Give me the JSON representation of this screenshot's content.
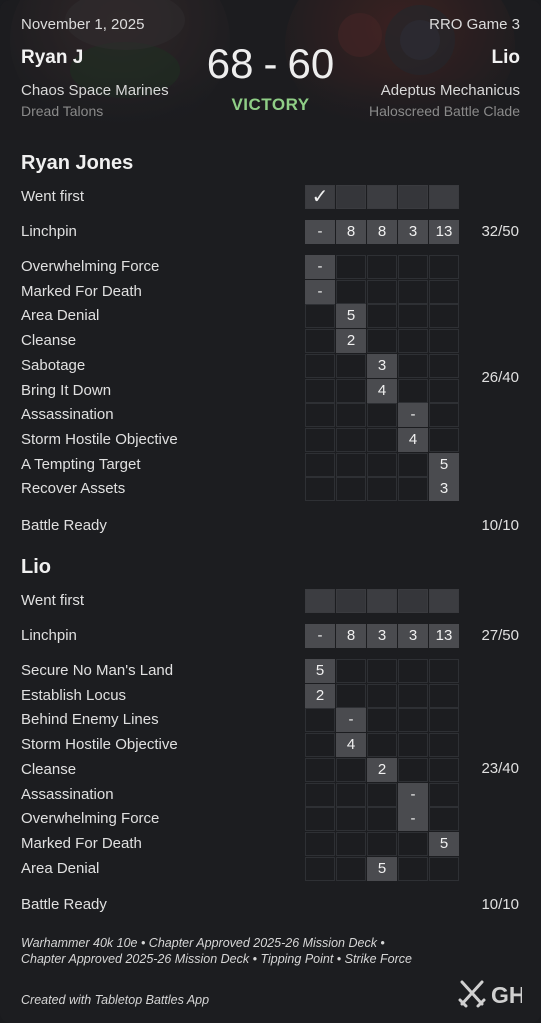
{
  "header": {
    "date": "November 1, 2025",
    "game_label": "RRO Game 3",
    "player1_short": "Ryan J",
    "player2_short": "Lio",
    "score1": "68",
    "score_sep": "-",
    "score2": "60",
    "result": "VICTORY",
    "player1_faction": "Chaos Space Marines",
    "player1_subfaction": "Dread Talons",
    "player2_faction": "Adeptus Mechanicus",
    "player2_subfaction": "Haloscreed Battle Clade"
  },
  "players": [
    {
      "name": "Ryan Jones",
      "went_first_label": "Went first",
      "went_first_mark": "✓",
      "went_first_round": 1,
      "linchpin_label": "Linchpin",
      "linchpin": [
        "-",
        "8",
        "8",
        "3",
        "13"
      ],
      "linchpin_total": "32/50",
      "secondaries": [
        {
          "label": "Overwhelming Force",
          "round": 1,
          "value": "-"
        },
        {
          "label": "Marked For Death",
          "round": 1,
          "value": "-"
        },
        {
          "label": "Area Denial",
          "round": 2,
          "value": "5"
        },
        {
          "label": "Cleanse",
          "round": 2,
          "value": "2"
        },
        {
          "label": "Sabotage",
          "round": 3,
          "value": "3"
        },
        {
          "label": "Bring It Down",
          "round": 3,
          "value": "4"
        },
        {
          "label": "Assassination",
          "round": 4,
          "value": "-"
        },
        {
          "label": "Storm Hostile Objective",
          "round": 4,
          "value": "4"
        },
        {
          "label": "A Tempting Target",
          "round": 5,
          "value": "5"
        },
        {
          "label": "Recover Assets",
          "round": 5,
          "value": "3"
        }
      ],
      "secondary_total": "26/40",
      "battle_ready_label": "Battle Ready",
      "battle_ready_total": "10/10"
    },
    {
      "name": "Lio",
      "went_first_label": "Went first",
      "went_first_mark": "",
      "went_first_round": 0,
      "linchpin_label": "Linchpin",
      "linchpin": [
        "-",
        "8",
        "3",
        "3",
        "13"
      ],
      "linchpin_total": "27/50",
      "secondaries": [
        {
          "label": "Secure No Man's Land",
          "round": 1,
          "value": "5"
        },
        {
          "label": "Establish Locus",
          "round": 1,
          "value": "2"
        },
        {
          "label": "Behind Enemy Lines",
          "round": 2,
          "value": "-"
        },
        {
          "label": "Storm Hostile Objective",
          "round": 2,
          "value": "4"
        },
        {
          "label": "Cleanse",
          "round": 3,
          "value": "2"
        },
        {
          "label": "Assassination",
          "round": 4,
          "value": "-"
        },
        {
          "label": "Overwhelming Force",
          "round": 4,
          "value": "-"
        },
        {
          "label": "Marked For Death",
          "round": 5,
          "value": "5"
        },
        {
          "label": "Area Denial",
          "round": 3,
          "value": "5"
        }
      ],
      "secondary_total": "23/40",
      "battle_ready_label": "Battle Ready",
      "battle_ready_total": "10/10"
    }
  ],
  "footer": {
    "details": "Warhammer 40k 10e • Chapter Approved 2025-26 Mission Deck • Chapter Approved 2025-26 Mission Deck • Tipping Point • Strike Force",
    "created": "Created with Tabletop Battles App",
    "logo_text": "GH",
    "logo_icon": "crossed-swords-icon"
  },
  "colors": {
    "background": "#1c1d20",
    "cell_filled": "#4a4b4f",
    "victory": "#8fce86"
  }
}
